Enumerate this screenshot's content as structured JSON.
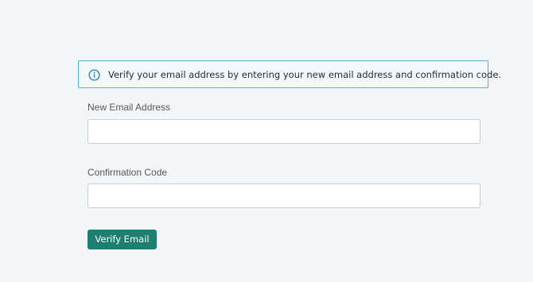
{
  "banner": {
    "icon": "info-icon",
    "text": "Verify your email address by entering your new email address and confirmation code.",
    "border_color": "#4fb3d9",
    "icon_color": "#2b7fa8"
  },
  "form": {
    "email": {
      "label": "New Email Address",
      "value": "",
      "placeholder": ""
    },
    "code": {
      "label": "Confirmation Code",
      "value": "",
      "placeholder": ""
    },
    "submit_label": "Verify Email",
    "submit_color": "#1c7f6f"
  }
}
